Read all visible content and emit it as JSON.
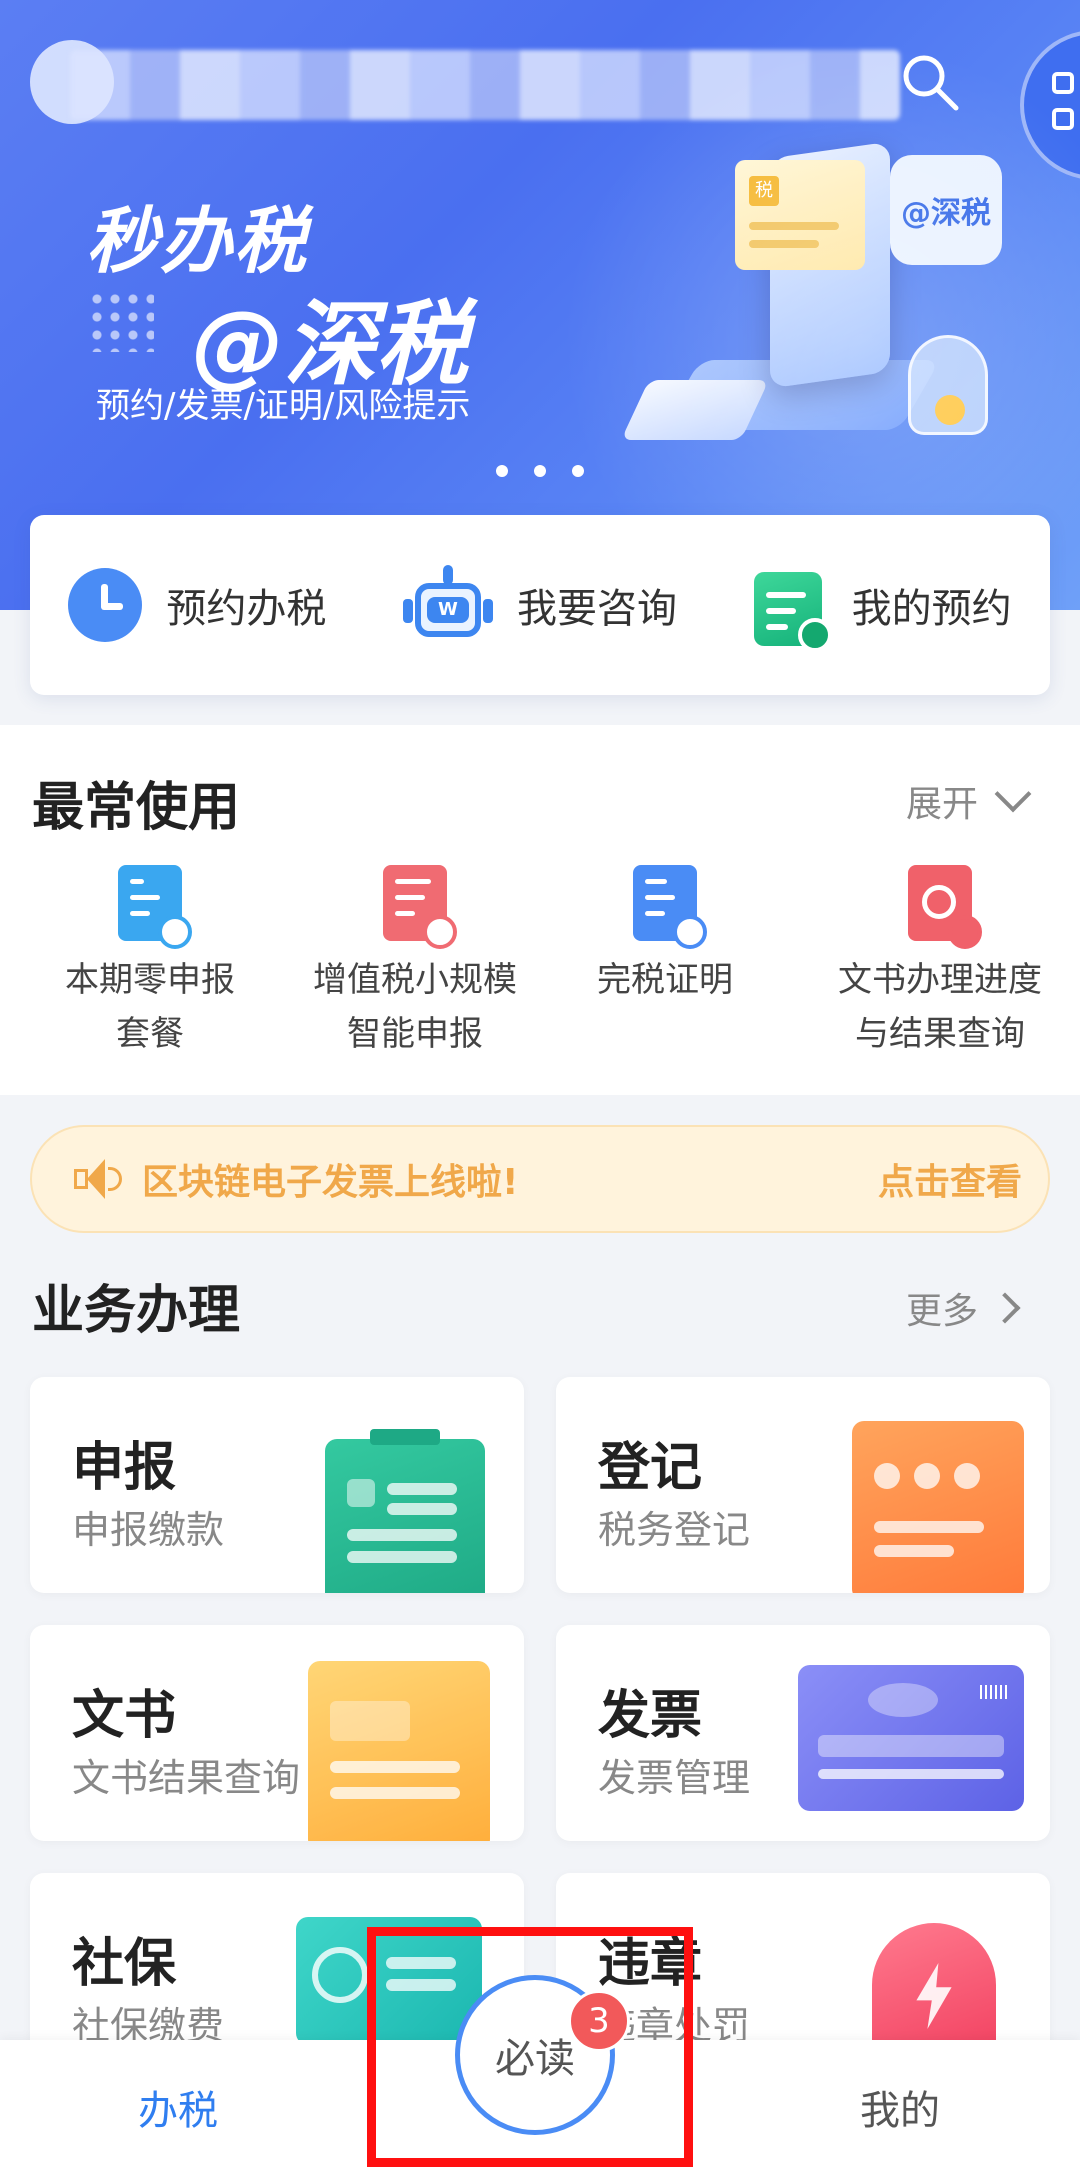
{
  "banner": {
    "title_line1": "秒办税",
    "title_line2": "@深税",
    "subtitle": "预约/发票/证明/风险提示",
    "bubble_text": "@深税",
    "card_text": "税",
    "pager_dots": 3
  },
  "quick_actions": [
    {
      "label": "预约办税",
      "icon": "clock-icon"
    },
    {
      "label": "我要咨询",
      "icon": "robot-icon"
    },
    {
      "label": "我的预约",
      "icon": "calendar-icon"
    }
  ],
  "robot_face": "W",
  "frequent": {
    "title": "最常使用",
    "expand_label": "展开",
    "items": [
      {
        "line1": "本期零申报",
        "line2": "套餐",
        "color": "#3aa7f0"
      },
      {
        "line1": "增值税小规模",
        "line2": "智能申报",
        "color": "#f06b72"
      },
      {
        "line1": "完税证明",
        "line2": "",
        "color": "#4a8cf5"
      },
      {
        "line1": "文书办理进度",
        "line2": "与结果查询",
        "color": "#f0616a"
      }
    ]
  },
  "notice": {
    "text": "区块链电子发票上线啦!",
    "link": "点击查看"
  },
  "business": {
    "title": "业务办理",
    "more_label": "更多",
    "cards": [
      {
        "title": "申报",
        "subtitle": "申报缴款"
      },
      {
        "title": "登记",
        "subtitle": "税务登记"
      },
      {
        "title": "文书",
        "subtitle": "文书结果查询"
      },
      {
        "title": "发票",
        "subtitle": "发票管理"
      },
      {
        "title": "社保",
        "subtitle": "社保缴费"
      },
      {
        "title": "违章",
        "subtitle": "违章处罚"
      }
    ]
  },
  "bottom_nav": {
    "tab1": "办税",
    "center": "必读",
    "center_badge": "3",
    "tab3": "我的"
  },
  "colors": {
    "accent": "#4a8cf5",
    "banner": "#5b7ef3",
    "notice": "#f0a84a",
    "badge": "#f2595a",
    "highlight": "#ff1010"
  }
}
